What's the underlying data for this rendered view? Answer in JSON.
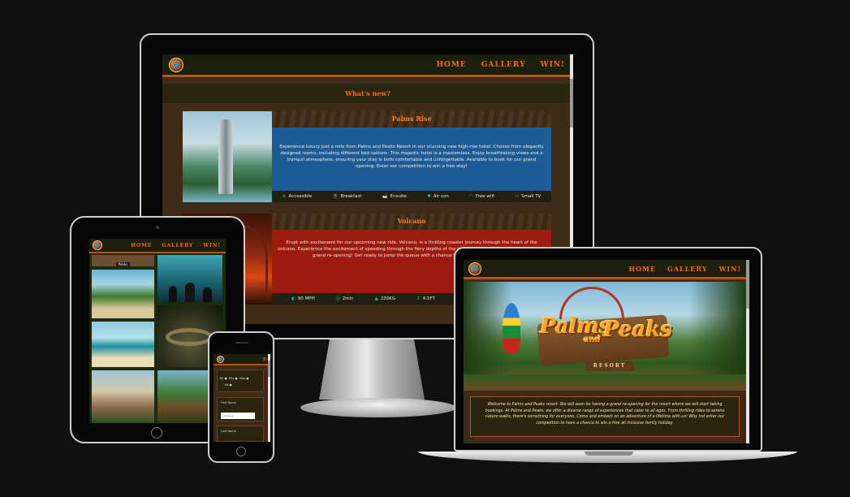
{
  "nav": {
    "home": "HOME",
    "gallery": "GALLERY",
    "win": "WIN!"
  },
  "desktop": {
    "section_title": "What's new?",
    "cards": [
      {
        "title": "Palms Rise",
        "description": "Experience luxury just a mile from Palms and Peaks Resort in our stunning new high-rise hotel. Choose from elegantly designed rooms, including different bed options. This majestic hotel is a masterclass. Enjoy breathtaking views and a tranquil atmosphere, ensuring your stay is both comfortable and unforgettable. Available to book for our grand opening. Enter our competition to win a free stay!",
        "amenities": [
          {
            "icon": "wheelchair-icon",
            "label": "Accessible"
          },
          {
            "icon": "cutlery-icon",
            "label": "Breakfast"
          },
          {
            "icon": "bath-icon",
            "label": "Ensuite"
          },
          {
            "icon": "fan-icon",
            "label": "Air con"
          },
          {
            "icon": "wifi-icon",
            "label": "Free wifi"
          },
          {
            "icon": "tv-icon",
            "label": "Small TV"
          }
        ]
      },
      {
        "title": "Volcano",
        "description": "Erupt with excitement for our upcoming new ride, Volcano, is a thrilling coaster journey through the heart of the volcano. Experience the excitement of speeding through the fiery depths of the earth. Don't miss out on this ride at our grand re-opening! Get ready to jump the queue with a chance to win in our competition.",
        "stats": [
          {
            "icon": "speed-icon",
            "label": "90 MPH"
          },
          {
            "icon": "clock-icon",
            "label": "2min"
          },
          {
            "icon": "weight-icon",
            "label": "230KG"
          },
          {
            "icon": "height-icon",
            "label": "4.5FT"
          }
        ]
      }
    ]
  },
  "tablet": {
    "first_caption": "Peaks"
  },
  "phone": {
    "titles": [
      "Mr",
      "Mrs",
      "Miss",
      "Ms"
    ],
    "first_name_label": "First Name",
    "first_name_placeholder": "Firstname",
    "last_name_label": "Last Name"
  },
  "laptop": {
    "logo_line1": "Palms",
    "logo_and": "and",
    "logo_line2": "Peaks",
    "logo_sub": "RESORT",
    "welcome": "Welcome to Palms and Peaks resort. We will soon be having a grand re-opening for the resort where we will start taking bookings. At Palms and Peaks, we offer a diverse range of experiences that cater to all ages. From thrilling rides to serene nature walks, there's something for everyone. Come and embark on an adventure of a lifetime with us! Why not enter our competition to have a chance to win a free all inclusive family holiday."
  },
  "colors": {
    "accent": "#ff6a00",
    "nav_bg": "#1c1f0e",
    "page_bg": "#3d2a17",
    "card_blue": "#1f5b94",
    "card_red": "#9c1a10",
    "icon_teal": "#2fc0c4"
  }
}
